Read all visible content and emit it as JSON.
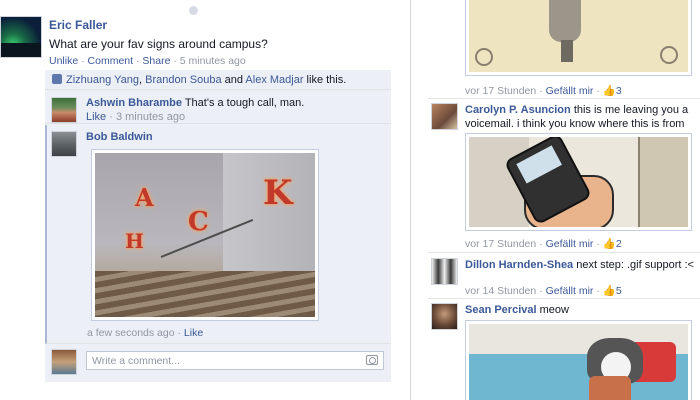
{
  "post": {
    "author": "Eric Faller",
    "text": "What are your fav signs around campus?",
    "actions": {
      "unlike": "Unlike",
      "comment": "Comment",
      "share": "Share",
      "time": "5 minutes ago",
      "sep": " · "
    },
    "likes": {
      "person1": "Zizhuang Yang",
      "sep1": ", ",
      "person2": "Brandon Souba",
      "and": " and ",
      "person3": "Alex Madjar",
      "suffix": " like this."
    },
    "comments": [
      {
        "author": "Ashwin Bharambe",
        "text": "That's a tough call, man.",
        "like": "Like",
        "time": "3 minutes ago"
      },
      {
        "author": "Bob Baldwin",
        "time": "a few seconds ago",
        "like": "Like",
        "photo_letters": [
          "A",
          "C",
          "K",
          "H"
        ]
      }
    ],
    "write_placeholder": "Write a comment..."
  },
  "feed": [
    {
      "meta_time": "vor 17 Stunden",
      "meta_like": "Gefällt mir",
      "meta_count": "3"
    },
    {
      "author": "Carolyn P. Asuncion",
      "text": "this is me leaving you a voicemail. i think you know where this is from",
      "meta_time": "vor 17 Stunden",
      "meta_like": "Gefällt mir",
      "meta_count": "2"
    },
    {
      "author": "Dillon Harnden-Shea",
      "text": "next step: .gif support :<",
      "meta_time": "vor 14 Stunden",
      "meta_like": "Gefällt mir",
      "meta_count": "5"
    },
    {
      "author": "Sean Percival",
      "text": "meow"
    }
  ],
  "colors": {
    "link": "#3b5998",
    "meta": "#9197a3",
    "comment_bg": "#eceff5"
  }
}
